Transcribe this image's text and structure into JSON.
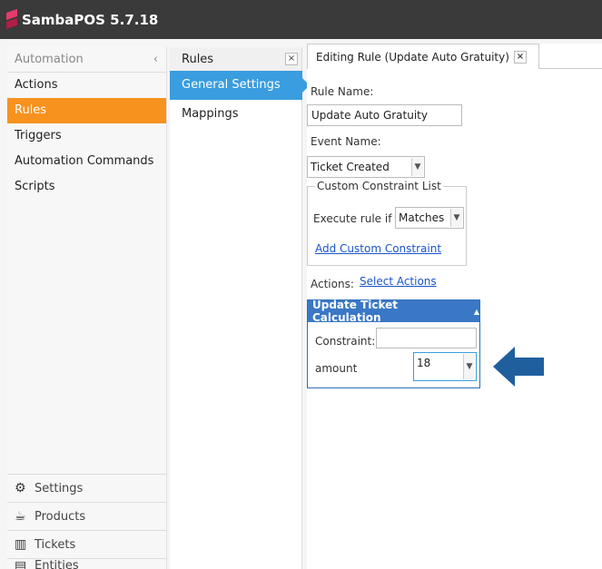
{
  "app": {
    "title": "SambaPOS 5.7.18"
  },
  "sidebar": {
    "header": "Automation",
    "collapse_glyph": "‹",
    "items": [
      {
        "label": "Actions"
      },
      {
        "label": "Rules"
      },
      {
        "label": "Triggers"
      },
      {
        "label": "Automation Commands"
      },
      {
        "label": "Scripts"
      }
    ],
    "bottom": [
      {
        "label": "Settings",
        "icon": "gear-icon"
      },
      {
        "label": "Products",
        "icon": "coffee-icon"
      },
      {
        "label": "Tickets",
        "icon": "tickets-icon"
      },
      {
        "label": "Entities",
        "icon": "entities-icon"
      }
    ]
  },
  "rules_panel": {
    "tab_label": "Rules",
    "close_glyph": "×",
    "items": [
      {
        "label": "General Settings"
      },
      {
        "label": "Mappings"
      }
    ]
  },
  "editor": {
    "tab_label": "Editing Rule (Update Auto Gratuity)",
    "close_glyph": "×",
    "rule_name_label": "Rule Name:",
    "rule_name_value": "Update Auto Gratuity",
    "event_name_label": "Event Name:",
    "event_name_value": "Ticket Created",
    "constraint_group_label": "Custom Constraint List",
    "execute_rule_label": "Execute rule if",
    "execute_rule_value": "Matches",
    "add_constraint_link": "Add Custom Constraint",
    "actions_label": "Actions:",
    "select_actions_link": "Select Actions",
    "action": {
      "title": "Update Ticket Calculation",
      "collapse_glyph": "▲",
      "constraint_label": "Constraint:",
      "constraint_value": "",
      "amount_label": "amount",
      "amount_value": "18"
    }
  },
  "colors": {
    "accent_orange": "#f7921e",
    "accent_blue": "#3a9ddf",
    "action_header": "#3a78c6",
    "arrow": "#1f5f9e"
  }
}
